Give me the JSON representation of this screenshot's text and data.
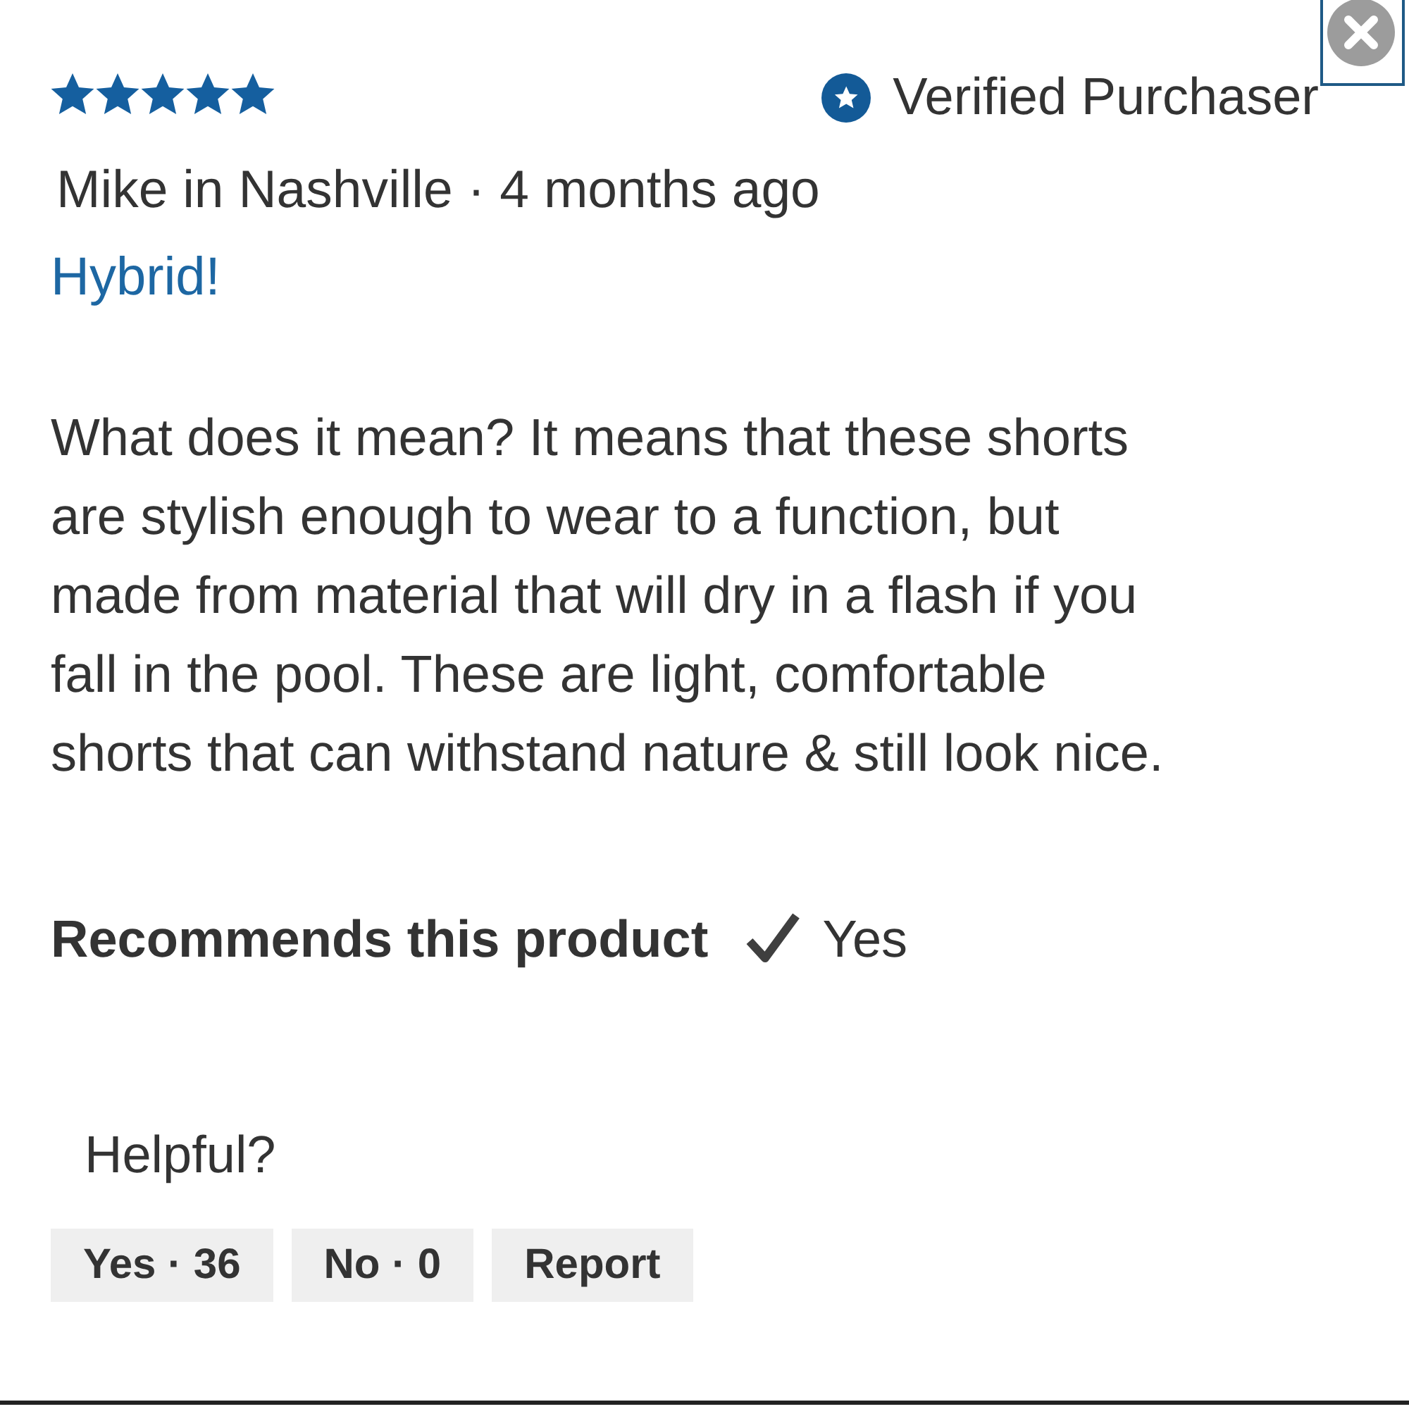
{
  "close_button": {
    "focused": true
  },
  "review": {
    "stars": 5,
    "verified_badge": "Verified Purchaser",
    "byline": "Mike in Nashville · 4 months ago",
    "title": "Hybrid!",
    "body": "What does it mean? It means that these shorts are stylish enough to wear to a function, but made from material that will dry in a flash if you fall in the pool. These are light, comfortable shorts that can withstand nature & still look nice.",
    "recommendation": {
      "label": "Recommends this product",
      "answer": "Yes"
    },
    "helpful": {
      "prompt": "Helpful?",
      "buttons": [
        {
          "label": "Yes · 36"
        },
        {
          "label": "No · 0"
        },
        {
          "label": "Report"
        }
      ]
    }
  }
}
